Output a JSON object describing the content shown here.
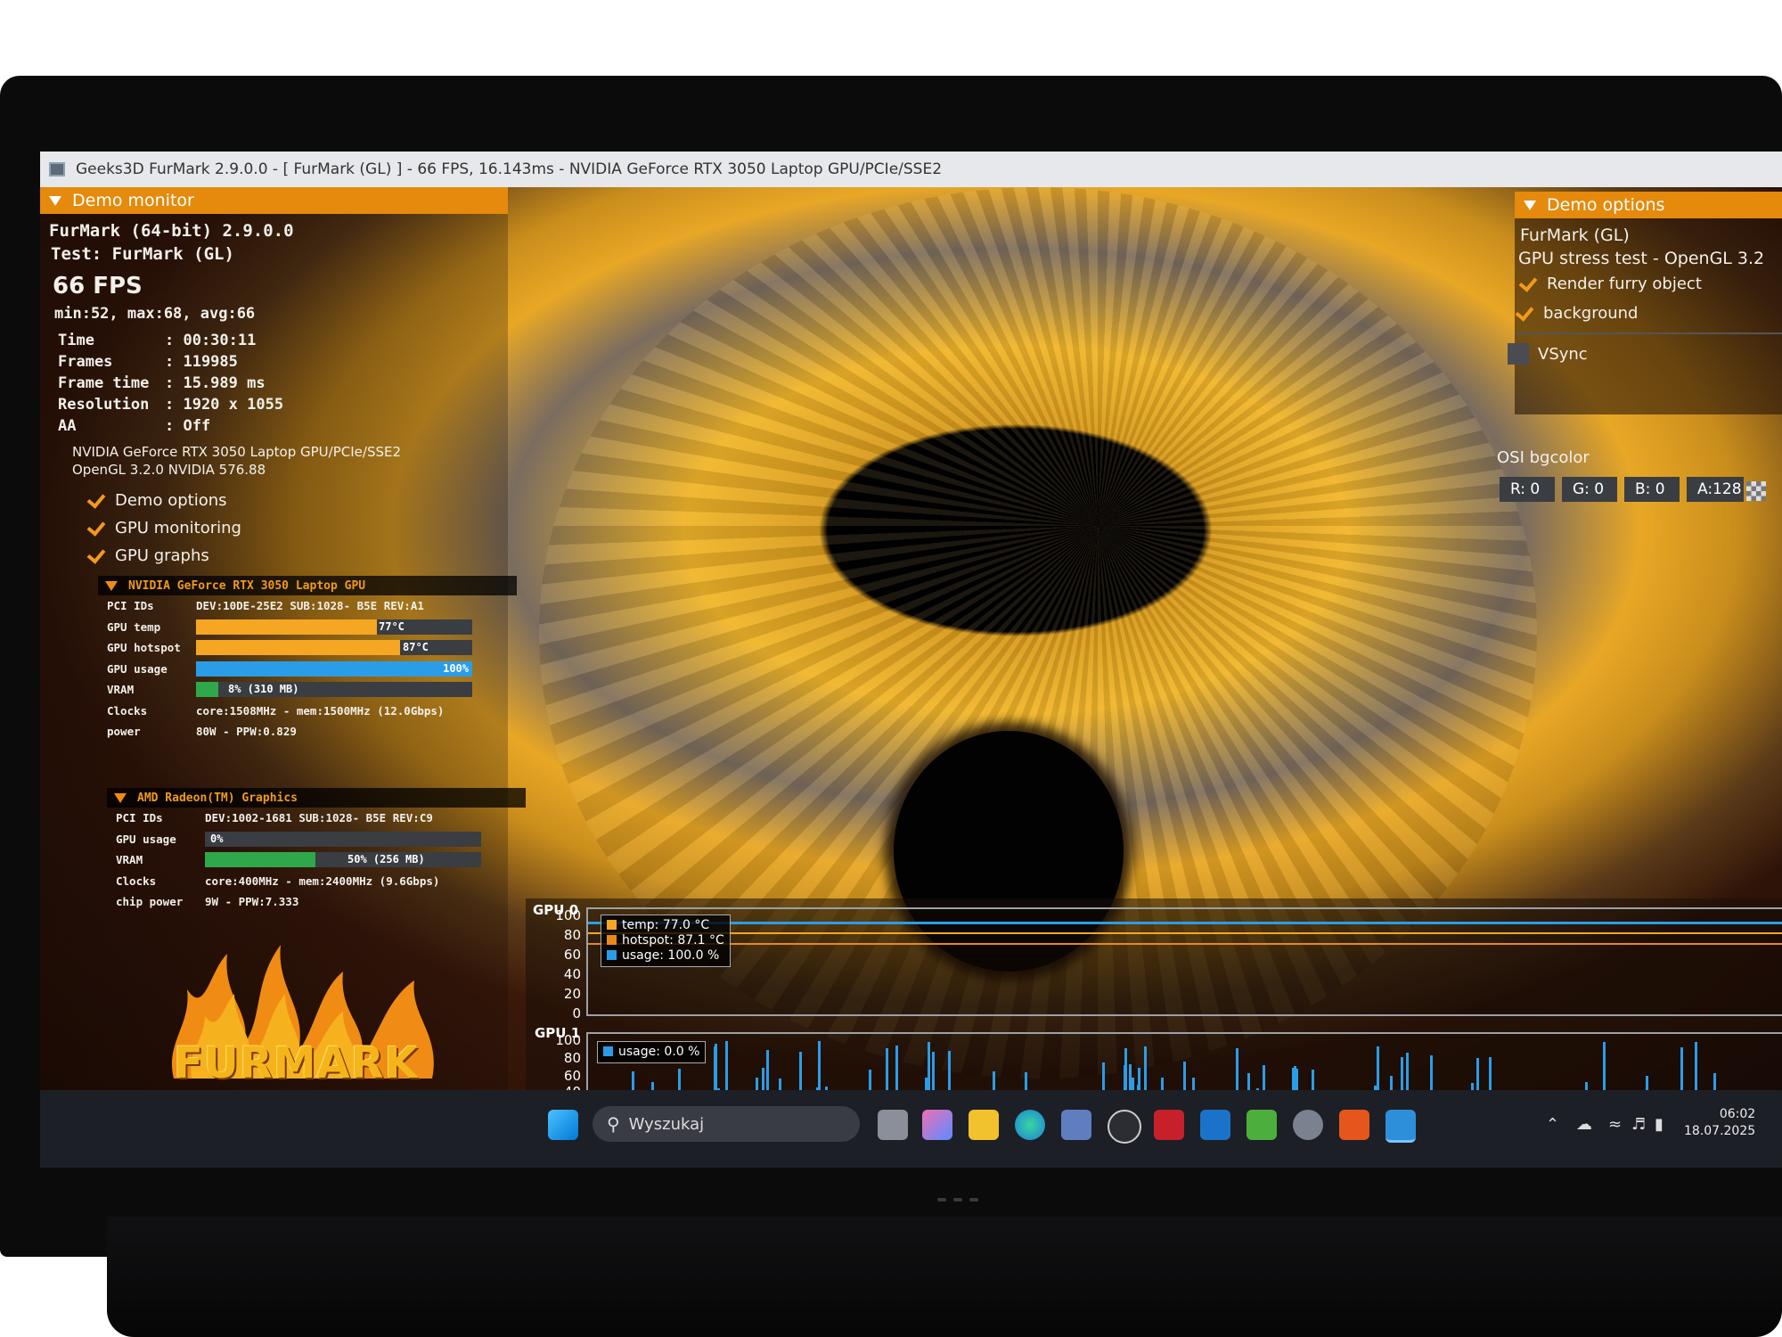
{
  "window": {
    "title": "Geeks3D FurMark 2.9.0.0 - [ FurMark (GL) ] - 66 FPS, 16.143ms - NVIDIA GeForce RTX 3050 Laptop GPU/PCIe/SSE2"
  },
  "monitor": {
    "header": "Demo monitor",
    "app_name": "FurMark (64-bit) 2.9.0.0",
    "test": "Test: FurMark (GL)",
    "fps": "66 FPS",
    "fps_stats": "min:52, max:68, avg:66",
    "stats": [
      {
        "key": "Time",
        "value": ": 00:30:11"
      },
      {
        "key": "Frames",
        "value": ": 119985"
      },
      {
        "key": "Frame time",
        "value": ": 15.989 ms"
      },
      {
        "key": "Resolution",
        "value": ": 1920 x 1055"
      },
      {
        "key": "AA",
        "value": ": Off"
      }
    ],
    "gpu_renderer": "NVIDIA GeForce RTX 3050 Laptop GPU/PCIe/SSE2",
    "opengl": "OpenGL 3.2.0 NVIDIA 576.88",
    "toggles": [
      "Demo options",
      "GPU monitoring",
      "GPU graphs"
    ]
  },
  "gpu0": {
    "header": "NVIDIA GeForce RTX 3050 Laptop GPU",
    "labels": [
      "PCI IDs",
      "GPU temp",
      "GPU hotspot",
      "GPU usage",
      "VRAM",
      "Clocks",
      "power"
    ],
    "pci_ids": "DEV:10DE-25E2 SUB:1028- B5E REV:A1",
    "temp_text": "77°C",
    "temp_fraction": 0.77,
    "hotspot_text": "87°C",
    "hotspot_fraction": 0.87,
    "usage_text": "100%",
    "usage_fraction": 1.0,
    "vram_text": "8% (310 MB)",
    "vram_fraction": 0.08,
    "clocks": "core:1508MHz - mem:1500MHz (12.0Gbps)",
    "power": "80W - PPW:0.829"
  },
  "gpu1": {
    "header": "AMD Radeon(TM) Graphics",
    "labels": [
      "PCI IDs",
      "GPU usage",
      "VRAM",
      "Clocks",
      "chip power"
    ],
    "pci_ids": "DEV:1002-1681 SUB:1028- B5E REV:C9",
    "usage_text": "0%",
    "usage_fraction": 0.0,
    "vram_text": "50% (256 MB)",
    "vram_fraction": 0.5,
    "clocks": "core:400MHz - mem:2400MHz (9.6Gbps)",
    "power": "9W - PPW:7.333"
  },
  "logo_text": "FURMARK",
  "options": {
    "header": "Demo options",
    "name": "FurMark (GL)",
    "subtitle": "GPU stress test - OpenGL 3.2",
    "render_fur": "Render furry object",
    "background": "background",
    "vsync": "VSync",
    "osi_label": "OSI bgcolor",
    "r": "R: 0",
    "g": "G: 0",
    "b": "B: 0",
    "a": "A:128"
  },
  "graphs": {
    "gpu0_label": "GPU 0",
    "gpu1_label": "GPU 1",
    "ticks0": [
      "100",
      "80",
      "60",
      "40",
      "20",
      "0"
    ],
    "ticks1": [
      "100",
      "80",
      "60",
      "40"
    ],
    "legend0": [
      "temp: 77.0 °C",
      "hotspot: 87.1 °C",
      "usage: 100.0 %"
    ],
    "legend1": [
      "usage: 0.0 %"
    ],
    "colors": {
      "temp": "#f5a623",
      "hotspot": "#e8891a",
      "usage": "#2a9de8"
    }
  },
  "taskbar": {
    "search_placeholder": "Wyszukaj",
    "time": "06:02",
    "date": "18.07.2025"
  }
}
